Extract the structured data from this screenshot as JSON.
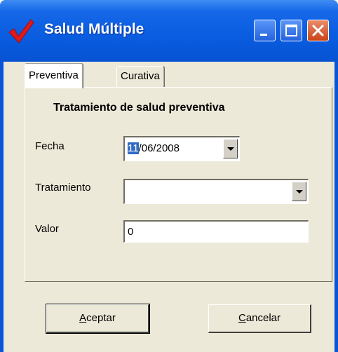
{
  "window": {
    "title": "Salud Múltiple",
    "buttons": {
      "minimize": "minimize",
      "maximize": "maximize",
      "close": "close"
    }
  },
  "tabs": [
    {
      "label": "Preventiva",
      "active": true
    },
    {
      "label": "Curativa",
      "active": false
    }
  ],
  "form": {
    "heading": "Tratamiento de salud preventiva",
    "fecha_label": "Fecha",
    "fecha_day": "11",
    "fecha_rest": "/06/2008",
    "tratamiento_label": "Tratamiento",
    "tratamiento_value": "",
    "valor_label": "Valor",
    "valor_value": "0"
  },
  "buttons": {
    "ok_mnemonic": "A",
    "ok_rest": "ceptar",
    "cancel_mnemonic": "C",
    "cancel_rest": "ancelar"
  },
  "colors": {
    "titlebar": "#0a5ce0",
    "client_bg": "#ece9d8",
    "selection": "#316ac5",
    "check": "#e0191b"
  },
  "icons": [
    "check-icon",
    "minimize-icon",
    "maximize-icon",
    "close-icon",
    "chevron-down-icon"
  ]
}
